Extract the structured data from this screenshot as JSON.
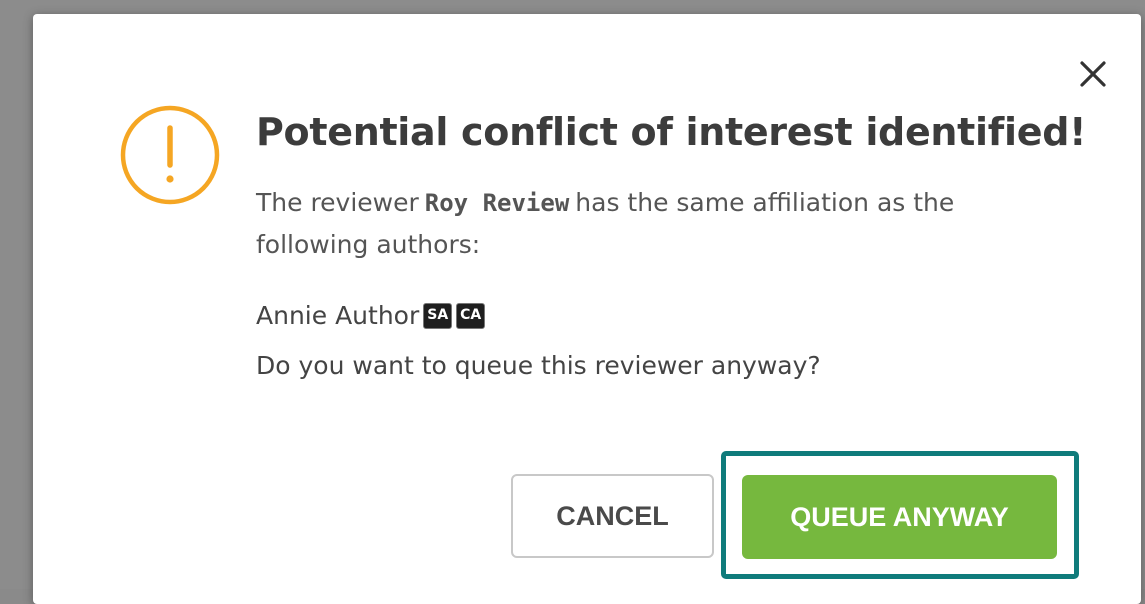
{
  "dialog": {
    "title": "Potential conflict of interest identified!",
    "message_prefix": "The reviewer",
    "reviewer_name": "Roy Review",
    "message_suffix": "has the same affiliation as the following authors:",
    "author": {
      "name": "Annie Author",
      "badges": [
        "SA",
        "CA"
      ]
    },
    "question": "Do you want to queue this reviewer anyway?",
    "buttons": {
      "cancel": "CANCEL",
      "confirm": "QUEUE ANYWAY"
    },
    "icons": {
      "close": "close-icon",
      "warning": "warning-icon"
    }
  },
  "colors": {
    "warning": "#f5a623",
    "confirm_button": "#76b83e",
    "focus_ring": "#0f7b7b",
    "badge_bg": "#1f1f1f"
  }
}
